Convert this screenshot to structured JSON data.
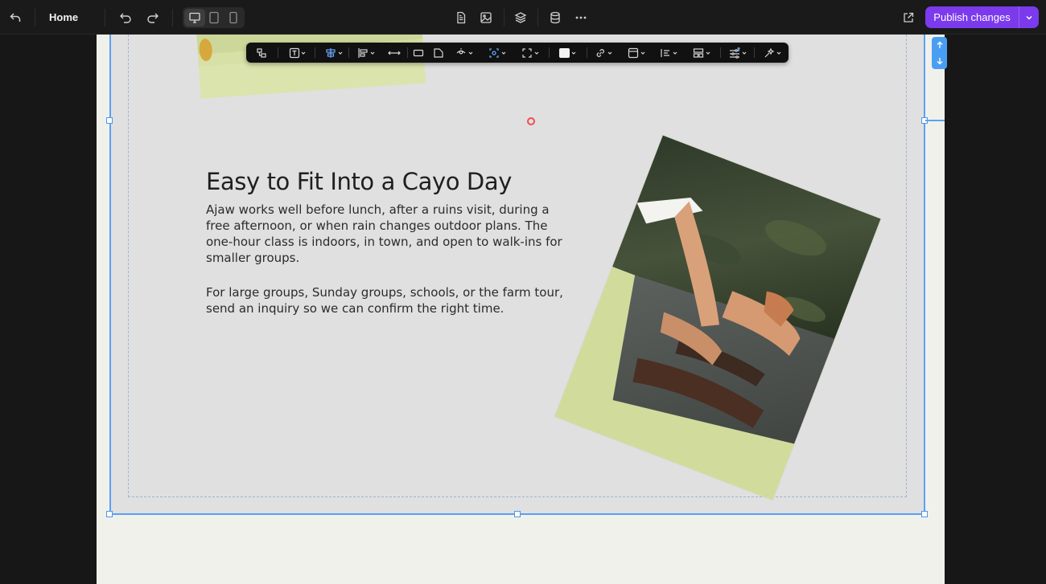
{
  "topbar": {
    "page_name": "Home",
    "publish_label": "Publish changes",
    "icons": [
      "back-arrow-icon",
      "undo-icon",
      "redo-icon",
      "desktop-icon",
      "tablet-icon",
      "mobile-icon",
      "page-icon",
      "image-icon",
      "layers-icon",
      "database-icon",
      "more-icon",
      "external-link-icon",
      "chevron-down-icon"
    ],
    "accent_color": "#7c3aed"
  },
  "section": {
    "headline": "Easy to Fit Into a Cayo Day",
    "paragraph_1": "Ajaw works well before lunch, after a ruins visit, during a free afternoon, or when rain changes outdoor plans. The one-hour class is indoors, in town, and open to walk-ins for smaller groups.",
    "paragraph_2": "For large groups, Sunday groups, schools, or the farm tour, send an inquiry so we can confirm the right time."
  },
  "floating_toolbar": {
    "icons": [
      "component-icon",
      "text-style-icon",
      "align-center-icon",
      "align-left-icon",
      "width-icon",
      "rectangle-icon",
      "corner-icon",
      "visibility-icon",
      "focus-icon",
      "fullscreen-icon",
      "fill-color-icon",
      "link-icon",
      "frame-icon",
      "list-icon",
      "layout-icon",
      "settings-sliders-icon",
      "effects-icon"
    ],
    "selection_color": "#5aa1f2"
  },
  "scroll_controls": {
    "icons": [
      "arrow-up-icon",
      "arrow-down-icon"
    ]
  }
}
